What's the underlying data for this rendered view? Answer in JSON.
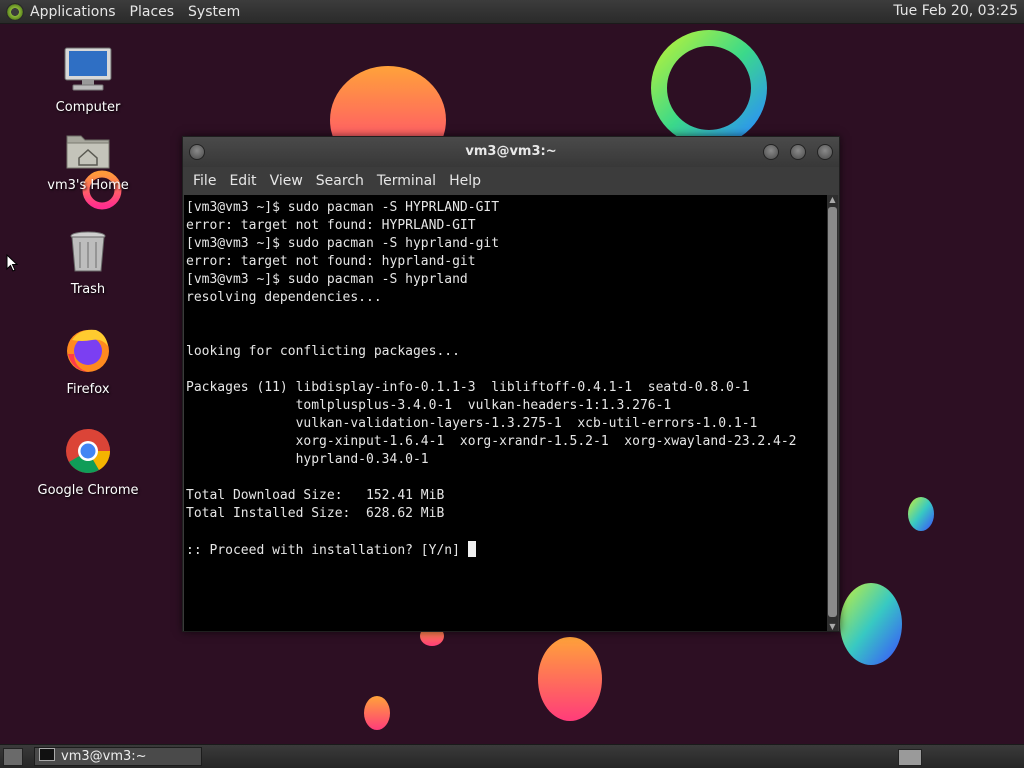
{
  "top_panel": {
    "menus": [
      "Applications",
      "Places",
      "System"
    ],
    "clock": "Tue Feb 20, 03:25"
  },
  "desktop_icons": {
    "computer": "Computer",
    "home": "vm3's Home",
    "trash": "Trash",
    "firefox": "Firefox",
    "chrome": "Google Chrome"
  },
  "terminal": {
    "title": "vm3@vm3:~",
    "menu": [
      "File",
      "Edit",
      "View",
      "Search",
      "Terminal",
      "Help"
    ],
    "lines": [
      "[vm3@vm3 ~]$ sudo pacman -S HYPRLAND-GIT",
      "error: target not found: HYPRLAND-GIT",
      "[vm3@vm3 ~]$ sudo pacman -S hyprland-git",
      "error: target not found: hyprland-git",
      "[vm3@vm3 ~]$ sudo pacman -S hyprland",
      "resolving dependencies...",
      "",
      "",
      "looking for conflicting packages...",
      "",
      "Packages (11) libdisplay-info-0.1.1-3  libliftoff-0.4.1-1  seatd-0.8.0-1",
      "              tomlplusplus-3.4.0-1  vulkan-headers-1:1.3.276-1",
      "              vulkan-validation-layers-1.3.275-1  xcb-util-errors-1.0.1-1",
      "              xorg-xinput-1.6.4-1  xorg-xrandr-1.5.2-1  xorg-xwayland-23.2.4-2",
      "              hyprland-0.34.0-1",
      "",
      "Total Download Size:   152.41 MiB",
      "Total Installed Size:  628.62 MiB",
      "",
      ":: Proceed with installation? [Y/n] "
    ]
  },
  "taskbar": {
    "window_button": "vm3@vm3:~"
  },
  "colors": {
    "wallpaper": "#2d0f23",
    "panel": "#333333",
    "terminal_bg": "#000000",
    "terminal_fg": "#e6e6e6"
  }
}
